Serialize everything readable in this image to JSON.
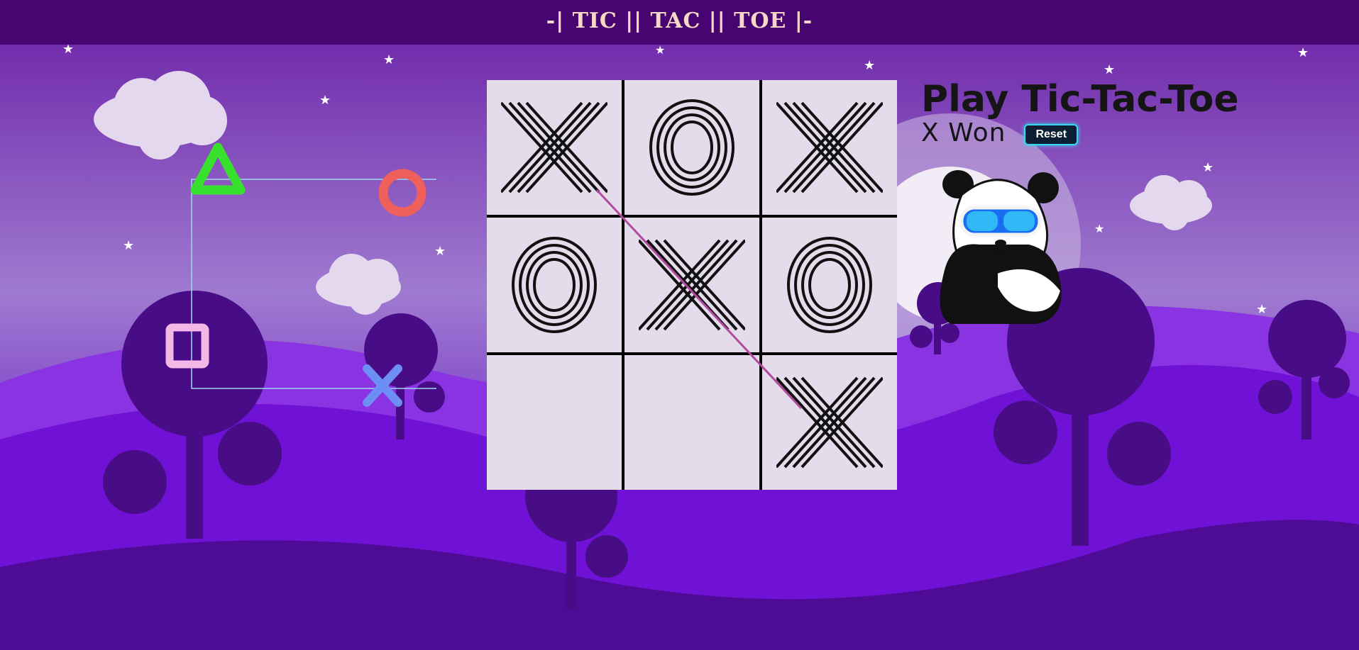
{
  "header": {
    "title": "-| TIC || TAC || TOE |-"
  },
  "game": {
    "heading": "Play Tic-Tac-Toe",
    "status": "X Won",
    "reset_label": "Reset",
    "board": [
      "X",
      "O",
      "X",
      "O",
      "X",
      "O",
      "",
      "",
      "X"
    ],
    "winning_line": [
      0,
      4,
      8
    ]
  },
  "icons": {
    "decor": [
      "triangle-icon",
      "circle-icon",
      "square-icon",
      "cross-icon"
    ],
    "mascot": "panda-with-goggles-icon"
  },
  "colors": {
    "navbar": "#460570",
    "nav_text": "#f6d9c5",
    "cell": "#e4dbeb",
    "win_line": "#b34aa0",
    "reset_border": "#36d8f0"
  }
}
